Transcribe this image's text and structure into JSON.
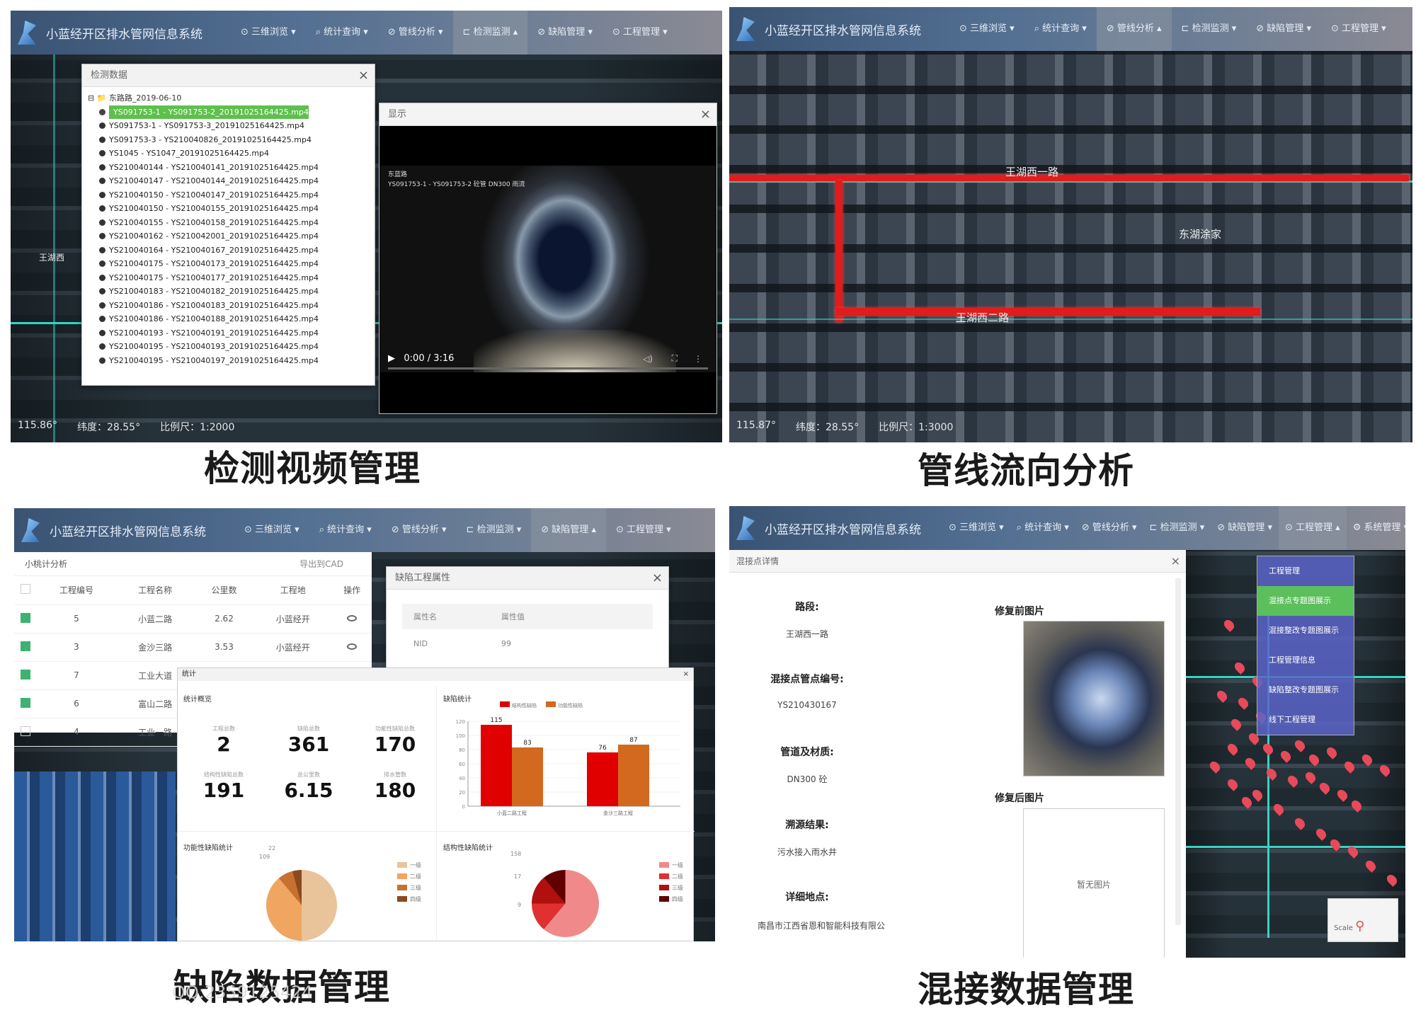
{
  "captions": {
    "video": "检测视频管理",
    "flow": "管线流向分析",
    "defect": "缺陷数据管理",
    "mixed": "混接数据管理"
  },
  "watermark": "QQ:2359125424",
  "app": {
    "title": "小蓝经开区排水管网信息系统",
    "menu": [
      "三维浏览",
      "统计查询",
      "管线分析",
      "检测监测",
      "缺陷管理",
      "工程管理"
    ],
    "menu_p4": [
      "三维浏览",
      "统计查询",
      "管线分析",
      "检测监测",
      "缺陷管理",
      "工程管理",
      "系统管理"
    ]
  },
  "panel1": {
    "window_title": "检测数据",
    "tree_root": "东路路_2019-06-10",
    "files": [
      "YS091753-1 - YS091753-2_20191025164425.mp4",
      "YS091753-1 - YS091753-3_20191025164425.mp4",
      "YS091753-3 - YS210040826_20191025164425.mp4",
      "YS1045 - YS1047_20191025164425.mp4",
      "YS210040144 - YS210040141_20191025164425.mp4",
      "YS210040147 - YS210040144_20191025164425.mp4",
      "YS210040150 - YS210040147_20191025164425.mp4",
      "YS210040150 - YS210040155_20191025164425.mp4",
      "YS210040155 - YS210040158_20191025164425.mp4",
      "YS210040162 - YS210042001_20191025164425.mp4",
      "YS210040164 - YS210040167_20191025164425.mp4",
      "YS210040175 - YS210040173_20191025164425.mp4",
      "YS210040175 - YS210040177_20191025164425.mp4",
      "YS210040183 - YS210040182_20191025164425.mp4",
      "YS210040186 - YS210040183_20191025164425.mp4",
      "YS210040186 - YS210040188_20191025164425.mp4",
      "YS210040193 - YS210040191_20191025164425.mp4",
      "YS210040195 - YS210040193_20191025164425.mp4",
      "YS210040195 - YS210040197_20191025164425.mp4"
    ],
    "video_window_title": "显示",
    "video_overlay_1": "东蓝路",
    "video_overlay_2": "YS091753-1 - YS091753-2   砼管   DN300   雨流",
    "video_time": "0:00 / 3:16",
    "status_lng": "115.86°",
    "status_lat": "纬度：28.55°",
    "status_scale": "比例尺：1:2000",
    "map_label": "王湖西"
  },
  "panel2": {
    "road_top": "王湖西一路",
    "road_bottom": "王湖西二路",
    "place": "东湖涂家",
    "status_lng": "115.87°",
    "status_lat": "纬度：28.55°",
    "status_scale": "比例尺：1:3000"
  },
  "panel3": {
    "side_title": "小桃计分析",
    "export_label": "导出到CAD",
    "columns": [
      "",
      "工程编号",
      "工程名称",
      "公里数",
      "工程地",
      "操作"
    ],
    "rows": [
      {
        "id": "5",
        "name": "小蓝二路",
        "km": "2.62",
        "place": "小蓝经开"
      },
      {
        "id": "3",
        "name": "金沙三路",
        "km": "3.53",
        "place": "小蓝经开"
      },
      {
        "id": "7",
        "name": "工业大道",
        "km": "",
        "place": ""
      },
      {
        "id": "6",
        "name": "富山二路",
        "km": "",
        "place": ""
      },
      {
        "id": "4",
        "name": "工业一路",
        "km": "",
        "place": ""
      }
    ],
    "prop_window_title": "缺陷工程属性",
    "prop_cols": [
      "属性名",
      "属性值"
    ],
    "prop_row": [
      "NID",
      "99"
    ],
    "stats_title": "统计",
    "stats_overview": "统计概览",
    "kpis": [
      {
        "label": "工程总数",
        "value": "2"
      },
      {
        "label": "缺陷总数",
        "value": "361"
      },
      {
        "label": "功能性缺陷总数",
        "value": "170"
      },
      {
        "label": "结构性缺陷总数",
        "value": "191"
      },
      {
        "label": "总公里数",
        "value": "6.15"
      },
      {
        "label": "排水管数",
        "value": "180"
      }
    ],
    "bar_title": "缺陷统计",
    "func_title": "功能性缺陷统计",
    "struct_title": "结构性缺陷统计",
    "pie_legend": [
      "一级",
      "二级",
      "三级",
      "四级"
    ],
    "struct_pie_labels": [
      "158",
      "17",
      "9"
    ],
    "func_pie_labels": [
      "109",
      "22"
    ]
  },
  "chart_data": {
    "type": "bar",
    "categories": [
      "小蓝二路工程",
      "金沙三路工程"
    ],
    "series": [
      {
        "name": "结构性缺陷",
        "values": [
          115,
          76
        ],
        "color": "#e00000"
      },
      {
        "name": "功能性缺陷",
        "values": [
          83,
          87
        ],
        "color": "#d2691e"
      }
    ],
    "yticks": [
      "120",
      "100",
      "80",
      "60",
      "40",
      "20",
      "0"
    ],
    "ylim": [
      0,
      120
    ]
  },
  "panel4": {
    "window_title": "混接点详情",
    "fields": [
      {
        "label": "路段:",
        "value": "王湖西一路"
      },
      {
        "label": "混接点管点编号:",
        "value": "YS210430167"
      },
      {
        "label": "管道及材质:",
        "value": "DN300 砼"
      },
      {
        "label": "溯源结果:",
        "value": "污水接入雨水井"
      },
      {
        "label": "详细地点:",
        "value": "南昌市江西省恩和智能科技有限公"
      }
    ],
    "before_label": "修复前图片",
    "after_label": "修复后图片",
    "no_image": "暂无图片",
    "dropdown": [
      "工程管理",
      "混接点专题图展示",
      "混接整改专题图展示",
      "工程管理信息",
      "缺陷整改专题图展示",
      "线下工程管理"
    ],
    "scale_label": "Scale"
  }
}
